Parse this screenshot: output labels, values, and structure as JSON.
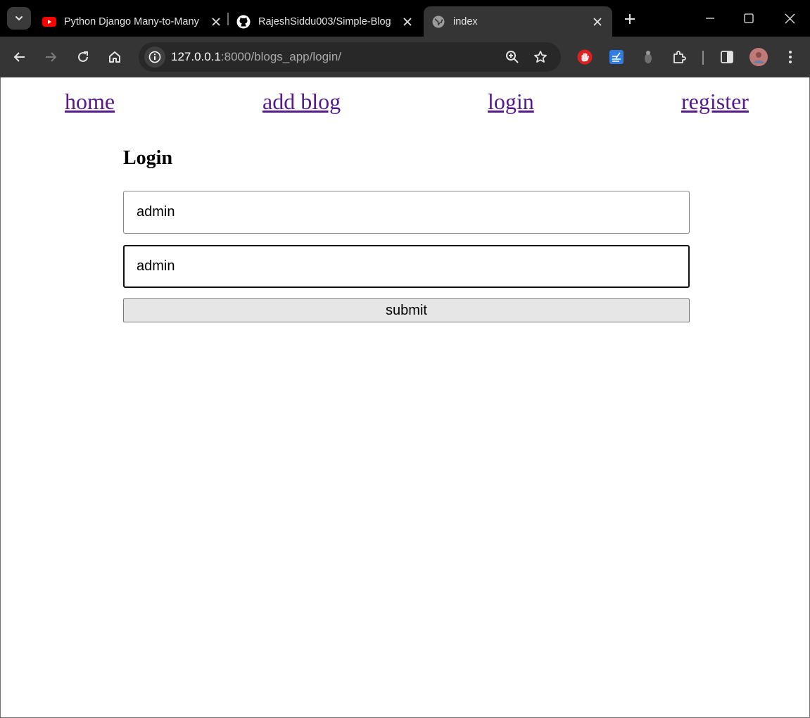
{
  "browser": {
    "tabs": [
      {
        "title": "Python Django Many-to-Many",
        "favicon": "youtube-icon",
        "active": false
      },
      {
        "title": "RajeshSiddu003/Simple-Blog",
        "favicon": "github-icon",
        "active": false
      },
      {
        "title": "index",
        "favicon": "globe-icon",
        "active": true
      }
    ],
    "url": {
      "host": "127.0.0.1",
      "rest": ":8000/blogs_app/login/"
    },
    "colors": {
      "tabstrip": "#000000",
      "toolbar": "#353535",
      "omnibox": "#282828"
    }
  },
  "nav": {
    "home": "home",
    "add_blog": "add blog",
    "login": "login",
    "register": "register"
  },
  "form": {
    "title": "Login",
    "username_value": "admin",
    "password_value": "admin",
    "submit_label": "submit"
  },
  "colors": {
    "link": "#551a8b"
  }
}
